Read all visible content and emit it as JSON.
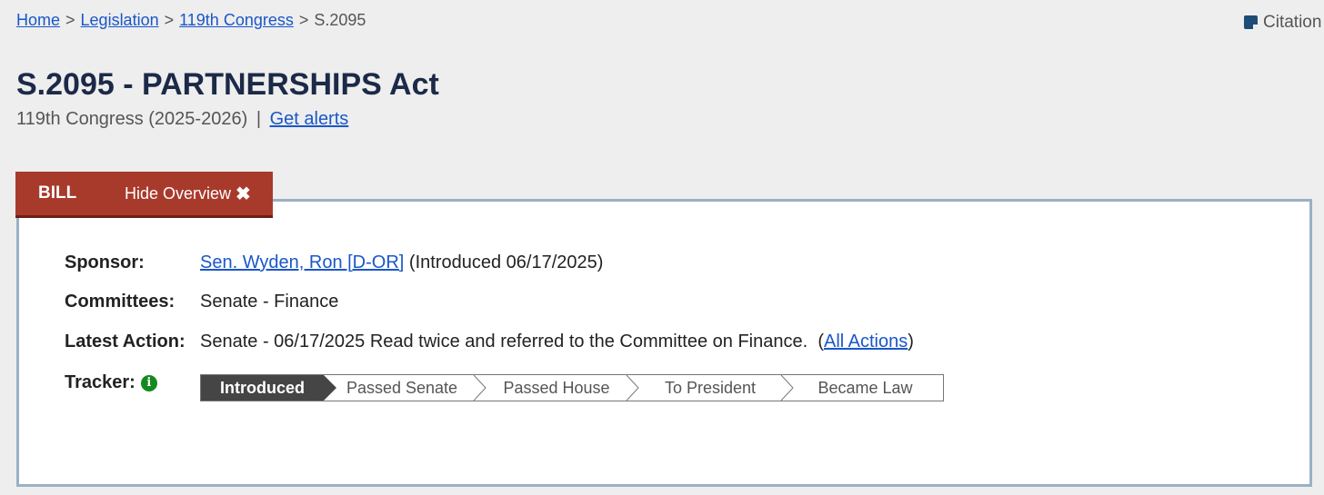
{
  "breadcrumb": {
    "home": "Home",
    "legislation": "Legislation",
    "congress": "119th Congress",
    "current": "S.2095",
    "separator": ">"
  },
  "citation": {
    "label": "Citation",
    "icon": "citation-icon"
  },
  "bill": {
    "title": "S.2095 - PARTNERSHIPS Act",
    "congress": "119th Congress (2025-2026)",
    "pipe": "|",
    "alerts_link": "Get alerts"
  },
  "tabs": {
    "bill": "BILL",
    "hide_overview": "Hide Overview",
    "close_glyph": "✖"
  },
  "overview": {
    "sponsor_label": "Sponsor:",
    "sponsor_name": "Sen. Wyden, Ron [D-OR]",
    "sponsor_intro": "(Introduced 06/17/2025)",
    "committees_label": "Committees:",
    "committees_value": "Senate - Finance",
    "latest_action_label": "Latest Action:",
    "latest_action_text": "Senate - 06/17/2025 Read twice and referred to the Committee on Finance.",
    "all_actions_open": "(",
    "all_actions_link": "All Actions",
    "all_actions_close": ")",
    "tracker_label": "Tracker:",
    "tracker_info_glyph": "i"
  },
  "tracker": {
    "steps": [
      "Introduced",
      "Passed Senate",
      "Passed House",
      "To President",
      "Became Law"
    ],
    "active_index": 0
  },
  "colors": {
    "accent_red": "#a83a2c",
    "link_blue": "#1a57c8",
    "title_navy": "#1c2a48",
    "active_step": "#454545",
    "info_green": "#138a1f"
  }
}
